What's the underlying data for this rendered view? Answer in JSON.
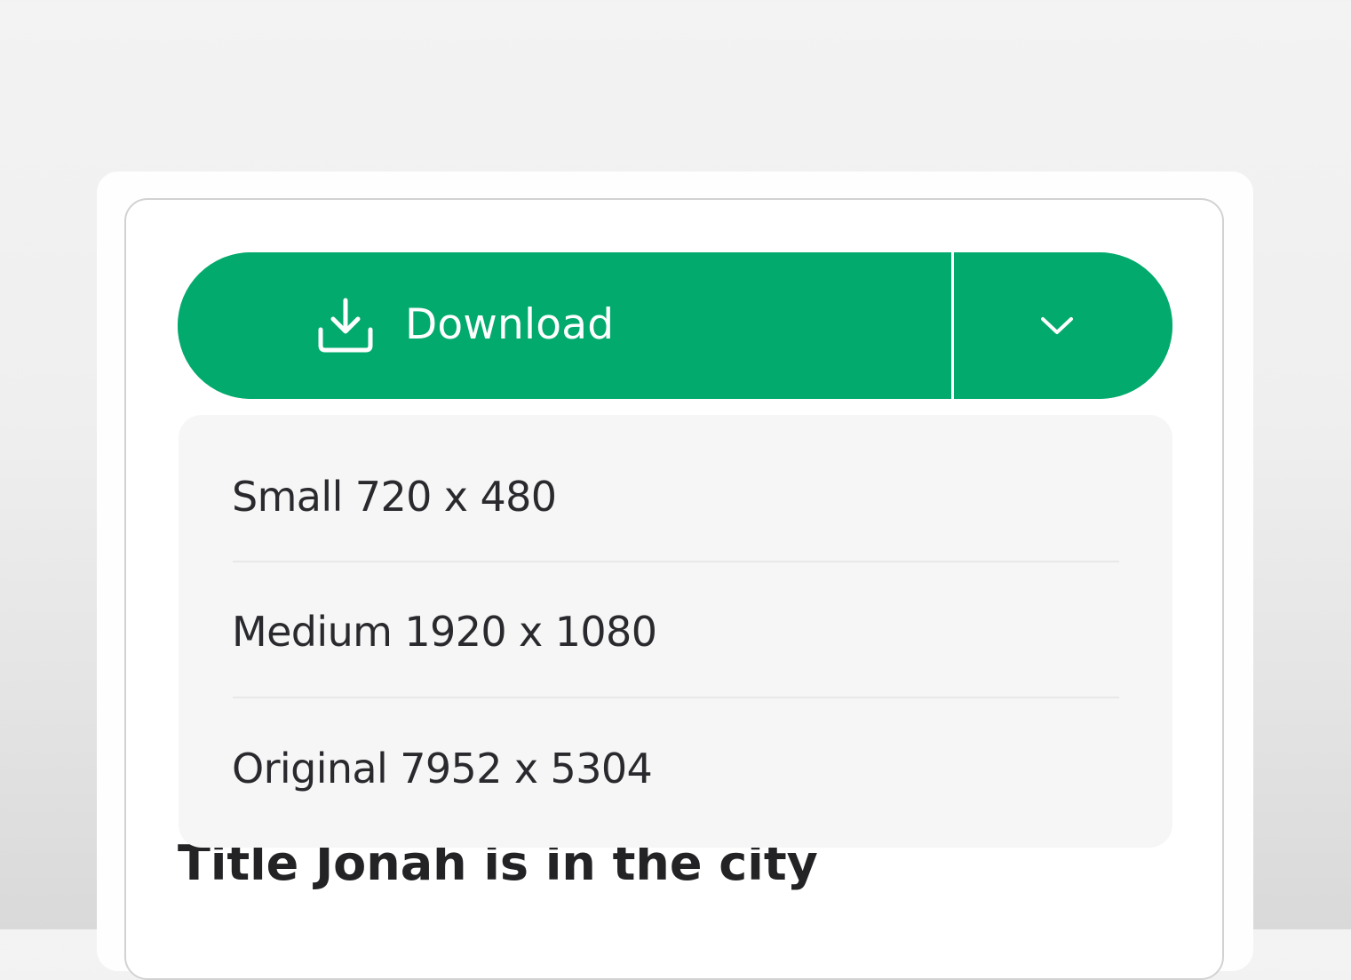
{
  "download_button": {
    "label": "Download",
    "icon": "download-icon",
    "color": "#03aa6d",
    "text_color": "#ffffff"
  },
  "dropdown_toggle": {
    "icon": "chevron-down-icon",
    "expanded": true
  },
  "size_menu": {
    "options": [
      {
        "label": "Small 720 x 480"
      },
      {
        "label": "Medium 1920 x 1080"
      },
      {
        "label": "Original 7952 x 5304"
      }
    ],
    "background": "#f6f6f6"
  },
  "content": {
    "title": "Title Jonah is in the city"
  }
}
